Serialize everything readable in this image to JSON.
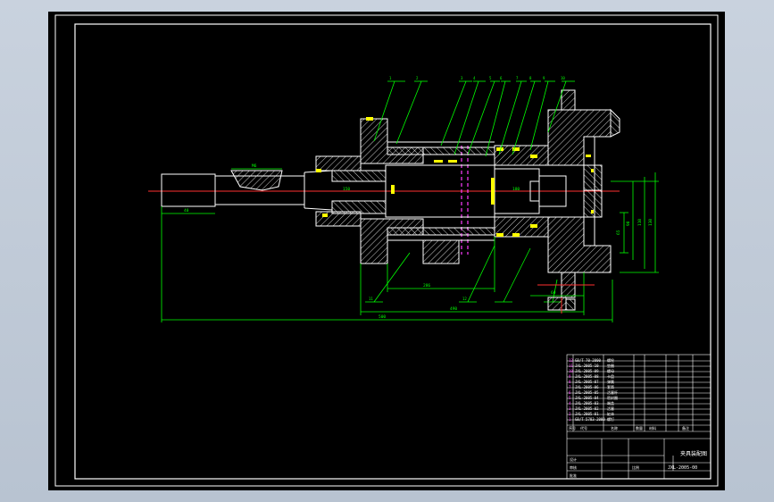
{
  "drawing": {
    "background": "#000000",
    "frame_color": "#ffffff",
    "geometry_color": "#ffffff",
    "hatch_color": "#ffff66",
    "centerline_color": "#ff3030",
    "dimension_color": "#00ff00",
    "accent_color": "#ff3cff",
    "seal_color": "#ffff00",
    "dim_text": [
      "M6",
      "286",
      "40",
      "490",
      "500",
      "60",
      "65",
      "90",
      "110",
      "130",
      "150",
      "180"
    ],
    "leader_numbers": [
      "1",
      "2",
      "3",
      "4",
      "5",
      "6",
      "7",
      "8",
      "9",
      "10",
      "11",
      "12"
    ]
  },
  "title_block": {
    "drawing_title": "夹具装配图",
    "drawing_number": "JXL-2005-00",
    "scale_label": "比例",
    "qty_label": "数量",
    "material_label": "材料",
    "designer_label": "设计",
    "checker_label": "审核",
    "approve_label": "批准",
    "seq_label": "序号",
    "code_label": "代号",
    "name_label": "名称",
    "remarks_label": "备注",
    "bom_rows": [
      {
        "code": "GB/T 5783-2000",
        "name": "螺钉"
      },
      {
        "code": "JXL-2005-01",
        "name": "缸体"
      },
      {
        "code": "JXL-2005-02",
        "name": "活塞"
      },
      {
        "code": "JXL-2005-03",
        "name": "端盖"
      },
      {
        "code": "JXL-2005-04",
        "name": "密封圈"
      },
      {
        "code": "JXL-2005-05",
        "name": "活塞杆"
      },
      {
        "code": "JXL-2005-06",
        "name": "套筒"
      },
      {
        "code": "JXL-2005-07",
        "name": "弹簧"
      },
      {
        "code": "JXL-2005-08",
        "name": "卡盘"
      },
      {
        "code": "JXL-2005-09",
        "name": "螺母"
      },
      {
        "code": "JXL-2005-10",
        "name": "垫圈"
      },
      {
        "code": "GB/T 70-2000",
        "name": "螺栓"
      }
    ]
  }
}
